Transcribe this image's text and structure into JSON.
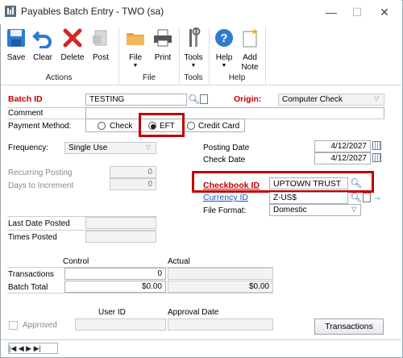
{
  "window": {
    "title": "Payables Batch Entry  -  TWO (sa)",
    "minimize": "—",
    "maximize": "☐",
    "close": "✕"
  },
  "ribbon": {
    "save": "Save",
    "clear": "Clear",
    "delete": "Delete",
    "post": "Post",
    "file": "File",
    "print": "Print",
    "tools": "Tools",
    "help": "Help",
    "add_note": "Add\nNote",
    "groups": {
      "actions": "Actions",
      "file": "File",
      "tools": "Tools",
      "help": "Help"
    }
  },
  "form": {
    "batch_id_label": "Batch ID",
    "batch_id_value": "TESTING",
    "origin_label": "Origin:",
    "origin_value": "Computer Check",
    "comment_label": "Comment",
    "comment_value": "",
    "payment_method_label": "Payment Method:",
    "payment_methods": {
      "check": "Check",
      "eft": "EFT",
      "credit_card": "Credit Card"
    },
    "frequency_label": "Frequency:",
    "frequency_value": "Single Use",
    "recurring_posting_label": "Recurring Posting",
    "recurring_posting_value": "0",
    "days_to_increment_label": "Days to Increment",
    "days_to_increment_value": "0",
    "posting_date_label": "Posting Date",
    "posting_date_value": "4/12/2027",
    "check_date_label": "Check Date",
    "check_date_value": "4/12/2027",
    "checkbook_id_label": "Checkbook ID",
    "checkbook_id_value": "UPTOWN TRUST",
    "currency_id_label": "Currency ID",
    "currency_id_value": "Z-US$",
    "file_format_label": "File Format:",
    "file_format_value": "Domestic",
    "last_date_posted_label": "Last Date Posted",
    "last_date_posted_value": "",
    "times_posted_label": "Times Posted",
    "times_posted_value": "",
    "control_header": "Control",
    "actual_header": "Actual",
    "transactions_label": "Transactions",
    "transactions_control": "0",
    "transactions_actual": "",
    "batch_total_label": "Batch Total",
    "batch_total_control": "$0.00",
    "batch_total_actual": "$0.00",
    "user_id_header": "User ID",
    "approval_date_header": "Approval Date",
    "approved_label": "Approved",
    "transactions_button": "Transactions"
  },
  "statusbar": {
    "nav": "|◀  ◀  ▶  ▶|"
  },
  "colors": {
    "accent_red": "#c00000",
    "link_blue": "#1a56c4",
    "icon_blue": "#2f7bd1"
  }
}
